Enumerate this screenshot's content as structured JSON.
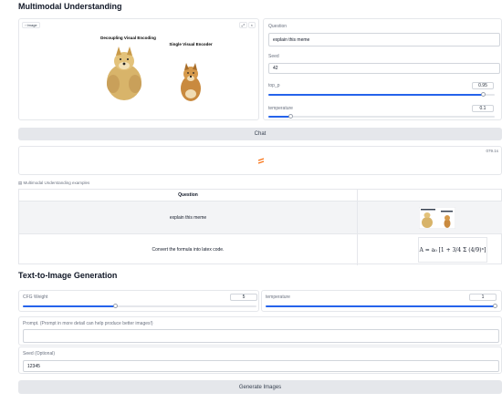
{
  "understanding": {
    "title": "Multimodal Understanding",
    "image_label": "Image",
    "meme_caption_left": "Decoupling Visual Encoding",
    "meme_caption_right": "Single Visual Encoder",
    "question_label": "Question",
    "question_value": "explain this meme",
    "seed_label": "Seed",
    "seed_value": "42",
    "top_p_label": "top_p",
    "top_p_value": "0.95",
    "top_p_fraction": 0.95,
    "temperature_label": "temperature",
    "temperature_value": "0.1",
    "temperature_fraction": 0.1,
    "chat_label": "Chat",
    "timer": "079.1s",
    "examples_label": "Multimodal Understanding examples",
    "examples_header": "Question",
    "examples": [
      {
        "question": "explain this meme"
      },
      {
        "question": "Convert the formula into latex code."
      }
    ],
    "formula_text": "A = a₀ [1 + 3/4 Σ (4/9)ⁿ]"
  },
  "generation": {
    "title": "Text-to-Image Generation",
    "cfg_label": "CFG Weight",
    "cfg_value": "5",
    "cfg_fraction": 0.4,
    "temperature_label": "temperature",
    "temperature_value": "1",
    "temperature_fraction": 1.0,
    "prompt_label": "Prompt. (Prompt in more detail can help produce better images!)",
    "prompt_value": "",
    "seed_label": "Seed (Optional)",
    "seed_value": "12345",
    "generate_label": "Generate Images"
  },
  "colors": {
    "accent": "#2563eb",
    "spinner": "#f97316"
  }
}
